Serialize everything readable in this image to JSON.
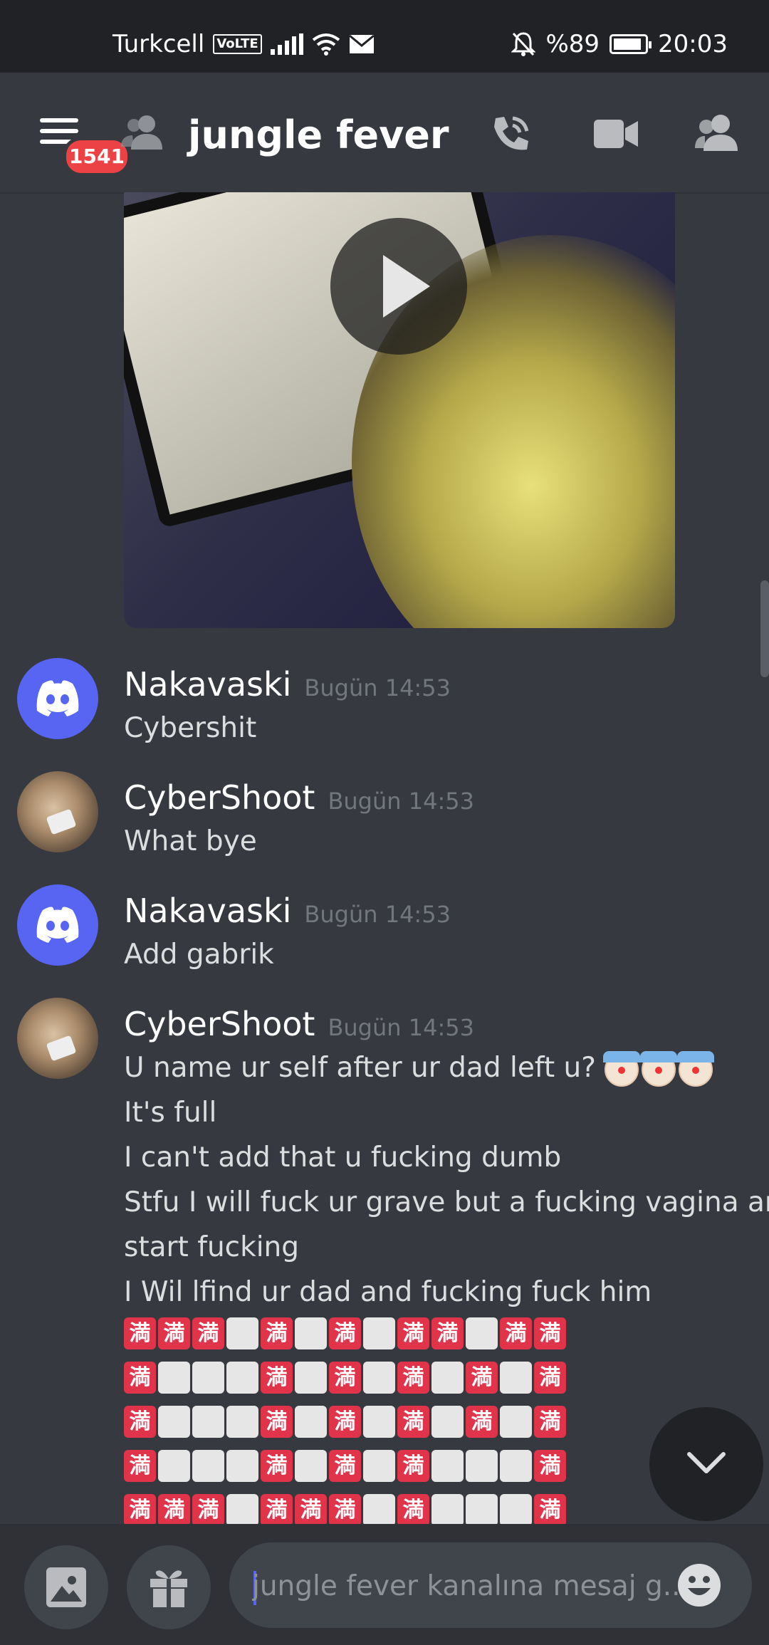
{
  "status_bar": {
    "carrier": "Turkcell",
    "volte": "VoLTE",
    "battery": "%89",
    "time": "20:03"
  },
  "header": {
    "title": "jungle fever",
    "badge_count": "1541",
    "icons": [
      "menu-icon",
      "group-icon",
      "call-icon",
      "video-call-icon",
      "members-icon"
    ]
  },
  "video": {
    "icon": "play-icon"
  },
  "messages": [
    {
      "author": "Nakavaski",
      "timestamp": "Bugün 14:53",
      "avatar": "discord-icon",
      "lines": [
        "Cybershit"
      ]
    },
    {
      "author": "CyberShoot",
      "timestamp": "Bugün 14:53",
      "avatar": "cat-photo",
      "lines": [
        "What bye"
      ]
    },
    {
      "author": "Nakavaski",
      "timestamp": "Bugün 14:53",
      "avatar": "discord-icon",
      "lines": [
        "Add gabrik"
      ]
    },
    {
      "author": "CyberShoot",
      "timestamp": "Bugün 14:53",
      "avatar": "cat-photo",
      "lines": [
        "U name ur self after ur dad left u?",
        "It's full",
        "I can't add that u fucking dumb",
        "Stfu I will fuck ur grave but a fucking vagina and",
        "start fucking",
        "I Wil lfind ur dad and fucking fuck him"
      ],
      "emoji_line_suffix": "clown-emoji x3",
      "emoji_grid": {
        "red_glyph": "満",
        "rows": [
          "RRRWRWRWRRWRR",
          "RWWWRWRWRWRWR",
          "RWWWRWRWRWRWR",
          "RWWWRWRWRWWWR",
          "RRRWRRRWRWWWR"
        ]
      }
    }
  ],
  "composer": {
    "placeholder": "jungle fever kanalına mesaj g...",
    "icons": [
      "image-icon",
      "gift-icon",
      "emoji-icon"
    ]
  },
  "colors": {
    "background": "#36393f",
    "blurple": "#5865f2",
    "badge_red": "#ed4245"
  }
}
